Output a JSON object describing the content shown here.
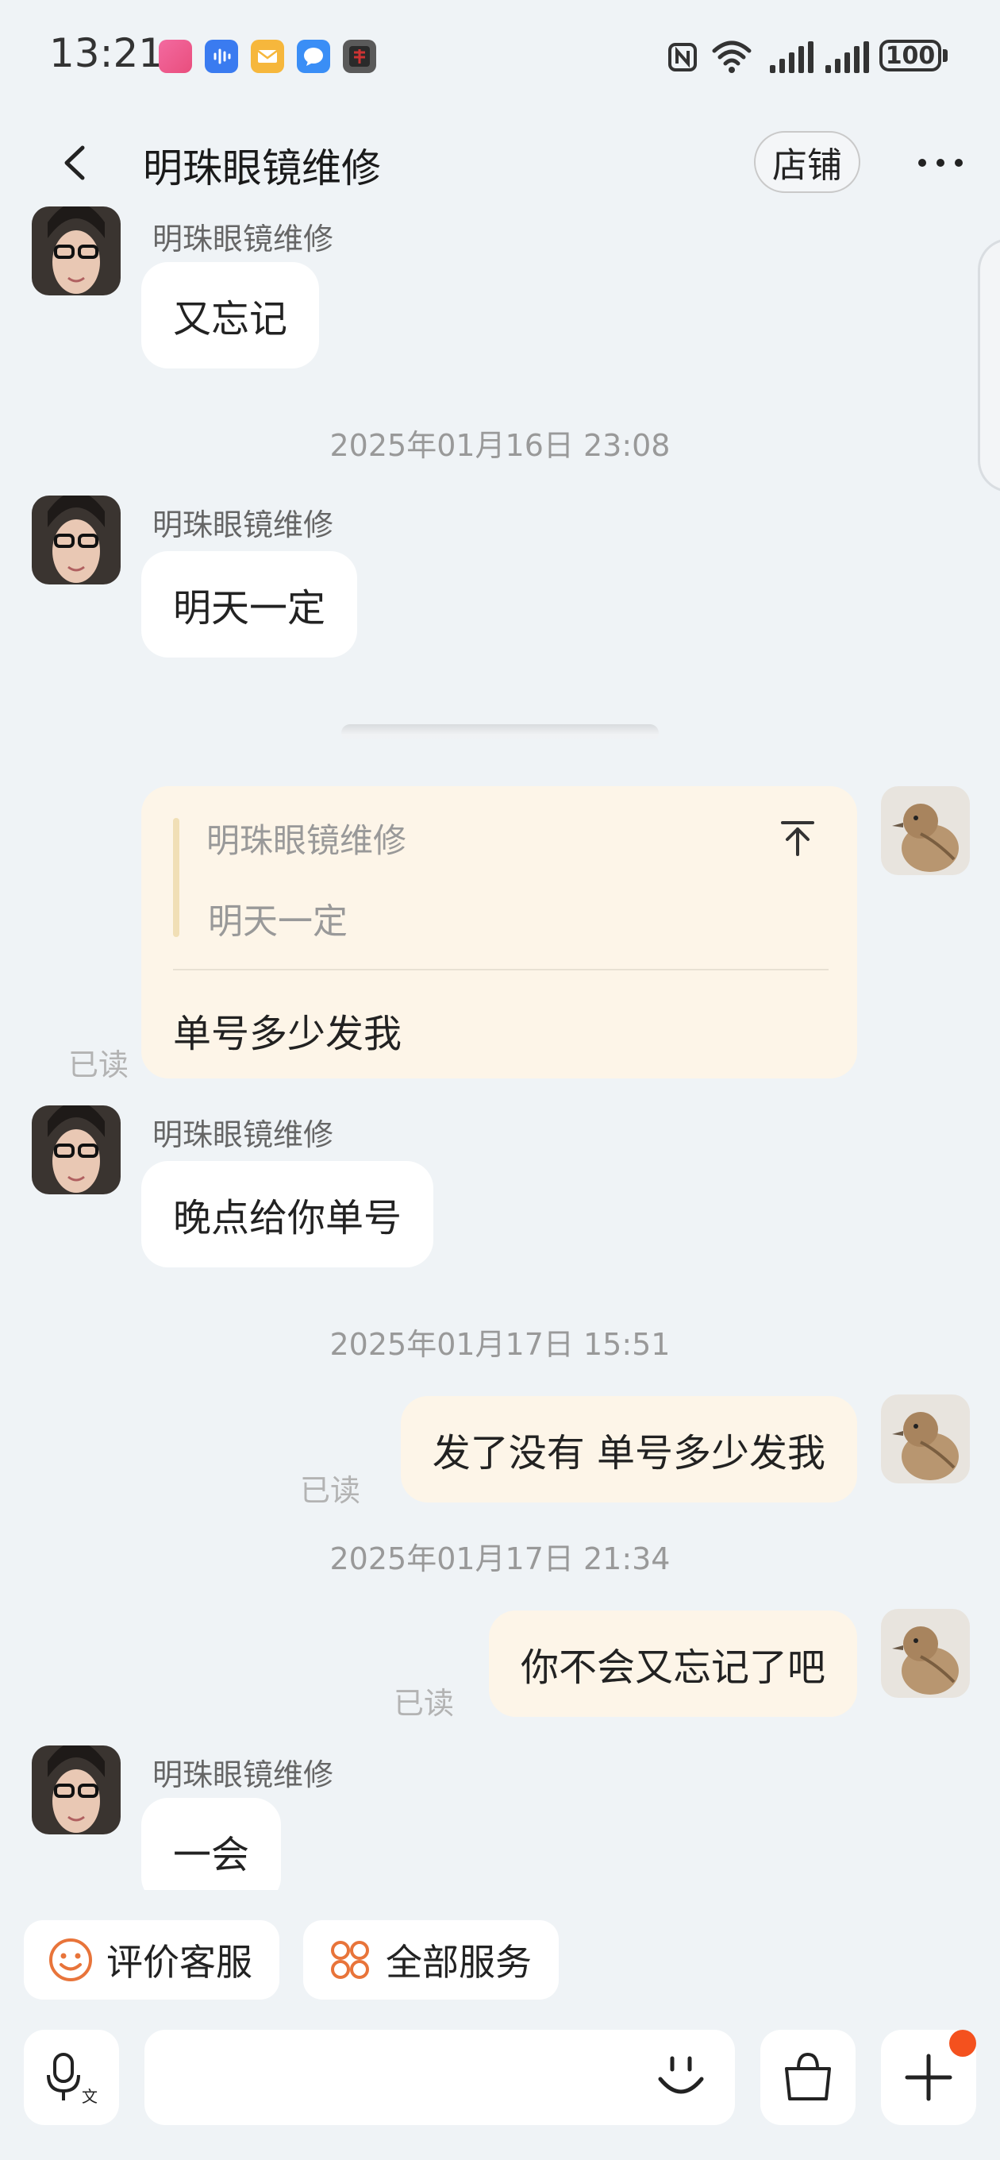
{
  "status_bar": {
    "time": "13:21",
    "battery": "100",
    "app_icons": [
      "bilibili-icon",
      "voice-recorder-icon",
      "mail-icon",
      "message-icon",
      "game-icon"
    ]
  },
  "header": {
    "title": "明珠眼镜维修",
    "shop_button": "店铺"
  },
  "messages": [
    {
      "side": "left",
      "sender": "明珠眼镜维修",
      "text": "又忘记"
    },
    {
      "timestamp": "2025年01月16日 23:08"
    },
    {
      "side": "left",
      "sender": "明珠眼镜维修",
      "text": "明天一定"
    },
    {
      "side": "right",
      "quote_sender": "明珠眼镜维修",
      "quote_text": "明天一定",
      "text": "单号多少发我",
      "status": "已读"
    },
    {
      "side": "left",
      "sender": "明珠眼镜维修",
      "text": "晚点给你单号"
    },
    {
      "timestamp": "2025年01月17日 15:51"
    },
    {
      "side": "right",
      "text": "发了没有 单号多少发我",
      "status": "已读"
    },
    {
      "timestamp": "2025年01月17日 21:34"
    },
    {
      "side": "right",
      "text": "你不会又忘记了吧",
      "status": "已读"
    },
    {
      "side": "left",
      "sender": "明珠眼镜维修",
      "text": "一会"
    }
  ],
  "quick_actions": [
    {
      "label": "评价客服",
      "icon": "smiley-icon"
    },
    {
      "label": "全部服务",
      "icon": "grid-icon"
    }
  ],
  "input_bar": {
    "voice_icon": "voice-input-icon",
    "emoji_icon": "emoji-icon",
    "bag_icon": "shopping-bag-icon",
    "plus_icon": "plus-icon"
  },
  "colors": {
    "background": "#eff3f6",
    "bubble_left": "#ffffff",
    "bubble_right": "#fdf5e8",
    "accent_orange": "#e8743a",
    "notification_dot": "#f4511e"
  }
}
